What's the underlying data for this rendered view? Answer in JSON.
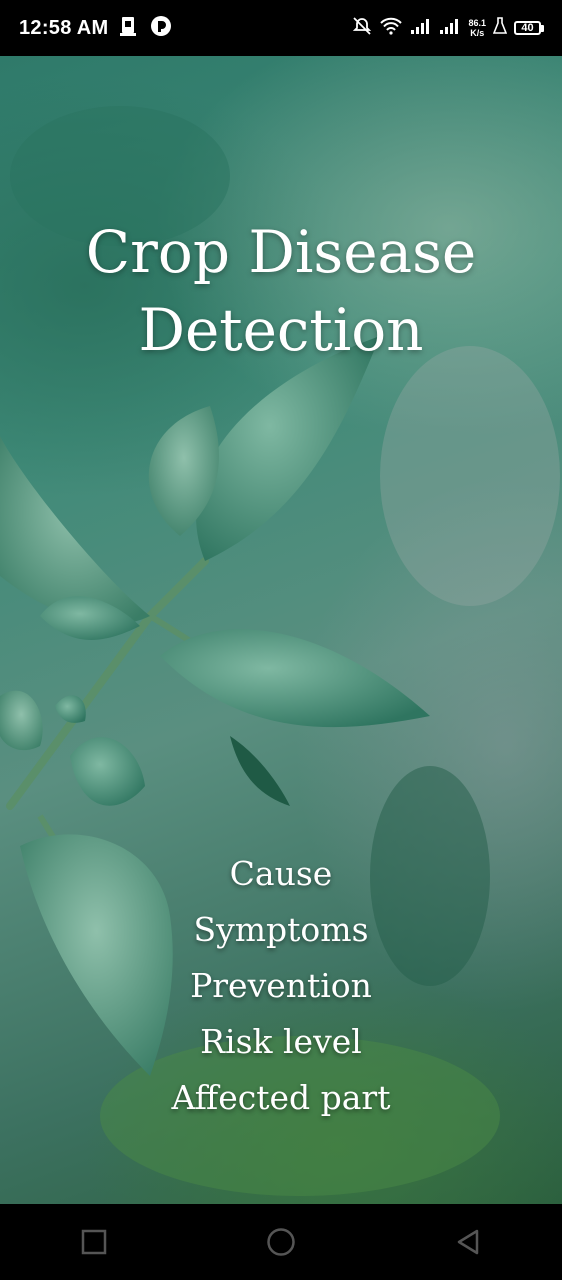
{
  "status_bar": {
    "time": "12:58 AM",
    "net_speed_value": "86.1",
    "net_speed_unit": "K/s",
    "battery_level": "40"
  },
  "hero": {
    "title": "Crop Disease Detection",
    "features": [
      "Cause",
      "Symptoms",
      "Prevention",
      "Risk level",
      "Affected part"
    ]
  },
  "nav": {
    "recents_icon": "square-icon",
    "home_icon": "circle-icon",
    "back_icon": "triangle-back-icon"
  }
}
